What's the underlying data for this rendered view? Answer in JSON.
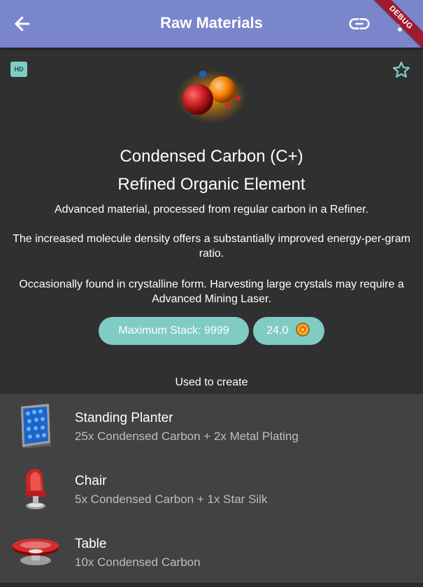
{
  "app_bar": {
    "title": "Raw Materials",
    "back_icon": "arrow-back-icon",
    "link_icon": "link-icon",
    "more_icon": "more-vert-icon",
    "color": "#7986cb"
  },
  "debug_banner": {
    "label": "DEBUG",
    "color": "#a0192e"
  },
  "header": {
    "hd_badge": "HD",
    "favourite_icon": "star-outline-icon",
    "accent": "#80cbc4"
  },
  "item": {
    "name": "Condensed Carbon (C+)",
    "group": "Refined Organic Element",
    "description": [
      "Advanced material, processed from regular carbon in a Refiner.",
      "The increased molecule density offers a substantially improved energy-per-gram ratio.",
      "Occasionally found in crystalline form. Harvesting large crystals may require a Advanced Mining Laser."
    ],
    "max_stack": "Maximum Stack: 9999",
    "value": "24.0",
    "value_icon": "units-coin-icon"
  },
  "used_to_create": {
    "title": "Used to create",
    "items": [
      {
        "name": "Standing Planter",
        "recipe": "25x Condensed Carbon + 2x Metal Plating",
        "icon": "standing-planter-icon"
      },
      {
        "name": "Chair",
        "recipe": "5x Condensed Carbon + 1x Star Silk",
        "icon": "chair-icon"
      },
      {
        "name": "Table",
        "recipe": "10x Condensed Carbon",
        "icon": "table-icon"
      }
    ]
  }
}
